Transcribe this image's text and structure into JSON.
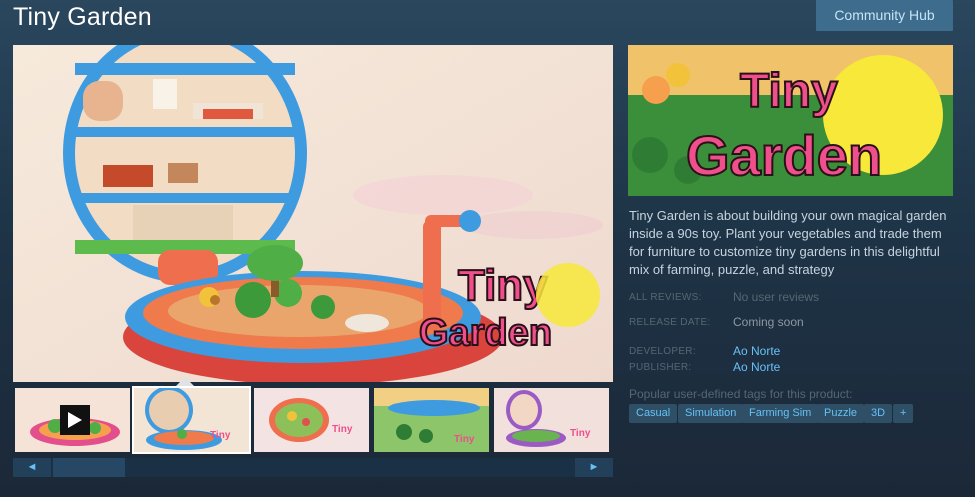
{
  "app": {
    "title": "Tiny Garden"
  },
  "header": {
    "community_hub_label": "Community Hub"
  },
  "media": {
    "logo_text_line1": "Tiny",
    "logo_text_line2": "Garden",
    "thumbnails": [
      {
        "kind": "video",
        "selected": false
      },
      {
        "kind": "image",
        "selected": true
      },
      {
        "kind": "image",
        "selected": false
      },
      {
        "kind": "image",
        "selected": false
      },
      {
        "kind": "image",
        "selected": false
      }
    ],
    "scroll_left_icon": "◄",
    "scroll_right_icon": "►"
  },
  "info": {
    "description": "Tiny Garden is about building your own magical garden inside a 90s toy. Plant your vegetables and trade them for furniture to customize tiny gardens in this delightful mix of farming, puzzle, and strategy",
    "all_reviews_label": "ALL REVIEWS:",
    "all_reviews_value": "No user reviews",
    "release_date_label": "RELEASE DATE:",
    "release_date_value": "Coming soon",
    "developer_label": "DEVELOPER:",
    "developer_value": "Ao Norte",
    "publisher_label": "PUBLISHER:",
    "publisher_value": "Ao Norte"
  },
  "tags": {
    "heading": "Popular user-defined tags for this product:",
    "items": [
      "Casual",
      "Simulation",
      "Farming Sim",
      "Puzzle",
      "3D",
      "+"
    ]
  },
  "colors": {
    "background": "#1b2838",
    "link": "#67c1f5",
    "tag_bg": "#2e4f66",
    "hub_button": "#3d6c8d",
    "logo_pink": "#ef4f8a",
    "logo_yellow": "#f7e83a"
  }
}
